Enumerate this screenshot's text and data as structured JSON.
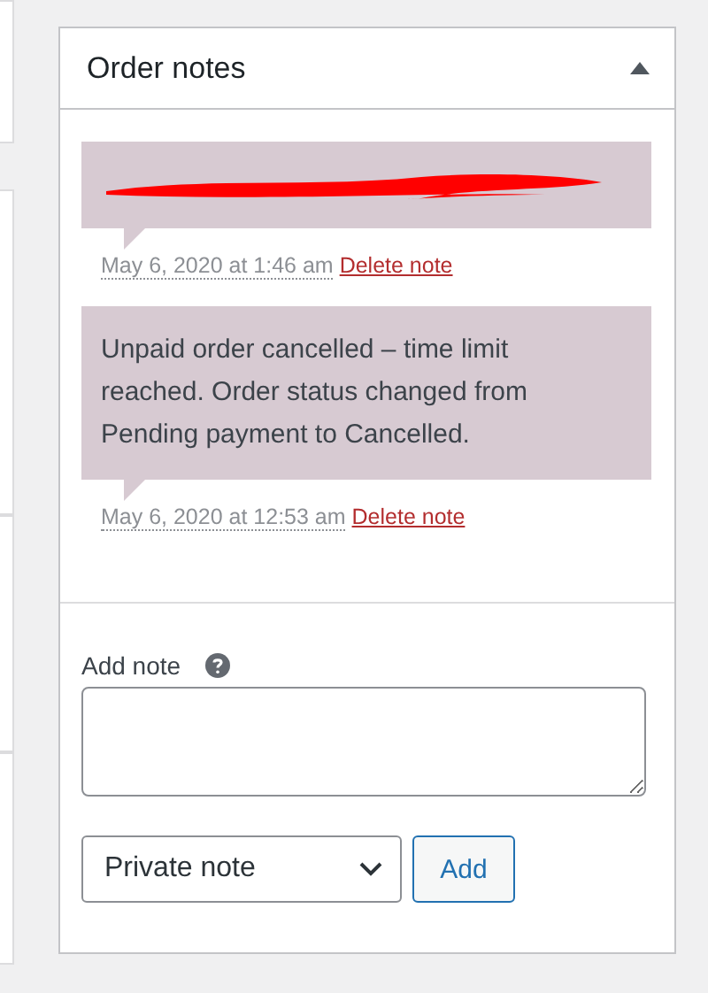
{
  "panel": {
    "title": "Order notes",
    "expanded": true
  },
  "notes": [
    {
      "kind": "redacted",
      "date": "May 6, 2020 at 1:46 am",
      "delete_label": "Delete note"
    },
    {
      "kind": "text",
      "text": "Unpaid order cancelled – time limit reached. Order status changed from Pending payment to Cancelled.",
      "date": "May 6, 2020 at 12:53 am",
      "delete_label": "Delete note"
    }
  ],
  "add_note": {
    "label": "Add note",
    "note_type": "Private note",
    "button": "Add"
  }
}
